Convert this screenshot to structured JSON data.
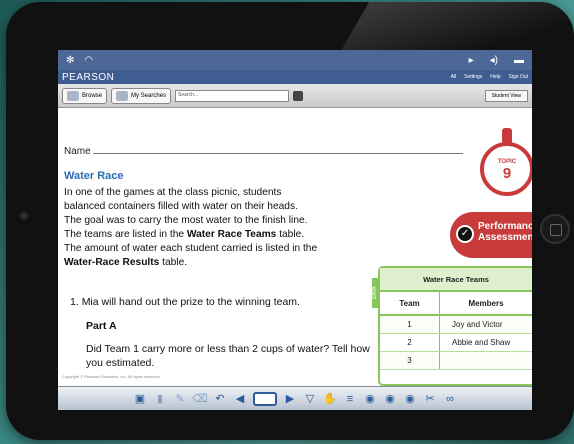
{
  "status": {
    "left_icons": [
      "bluetooth-icon",
      "wifi-icon"
    ],
    "right_icons": [
      "play-icon",
      "speaker-icon",
      "battery-icon"
    ]
  },
  "app": {
    "brand": "PEARSON",
    "top_links": [
      "All",
      "Settings",
      "Help",
      "Sign Out"
    ]
  },
  "toolbar": {
    "browse": "Browse",
    "my_searches": "My Searches",
    "search_placeholder": "Search...",
    "student_view": "Student View"
  },
  "worksheet": {
    "name_label": "Name",
    "title": "Water Race",
    "para_lines": [
      "In one of the games at the class picnic, students",
      "balanced containers filled with water on their heads.",
      "The goal was to carry the most water to the finish line.",
      "The teams are listed in the ",
      "Water Race Teams",
      " table.",
      "The amount of water each student carried is listed in the",
      "Water-Race Results",
      " table."
    ],
    "q1_num": "1.",
    "q1": "Mia will hand out the prize to the winning team.",
    "partA": "Part A",
    "qtext": "Did Team 1 carry more or less than 2 cups of water? Tell how you estimated.",
    "footer_fine": "Copyright © Pearson Education, Inc. All rights reserved."
  },
  "topic": {
    "label": "TOPIC",
    "number": "9",
    "perf_line1": "Performance",
    "perf_line2": "Assessment"
  },
  "data_table": {
    "tab": "DATA",
    "title": "Water Race Teams",
    "headers": [
      "Team",
      "Members"
    ],
    "rows": [
      [
        "1",
        "Joy and Victor"
      ],
      [
        "2",
        "Abbie and Shaw"
      ],
      [
        "3",
        ""
      ]
    ]
  },
  "bottom_toolbar": [
    "reader-icon",
    "bookmark-icon",
    "pen-icon",
    "eraser-icon",
    "undo-icon",
    "back-arrow-icon",
    "blank-page",
    "forward-arrow-icon",
    "next-page-icon",
    "hand-icon",
    "notes-icon",
    "users-icon",
    "users-icon",
    "users-icon",
    "share-icon",
    "glasses-icon"
  ]
}
